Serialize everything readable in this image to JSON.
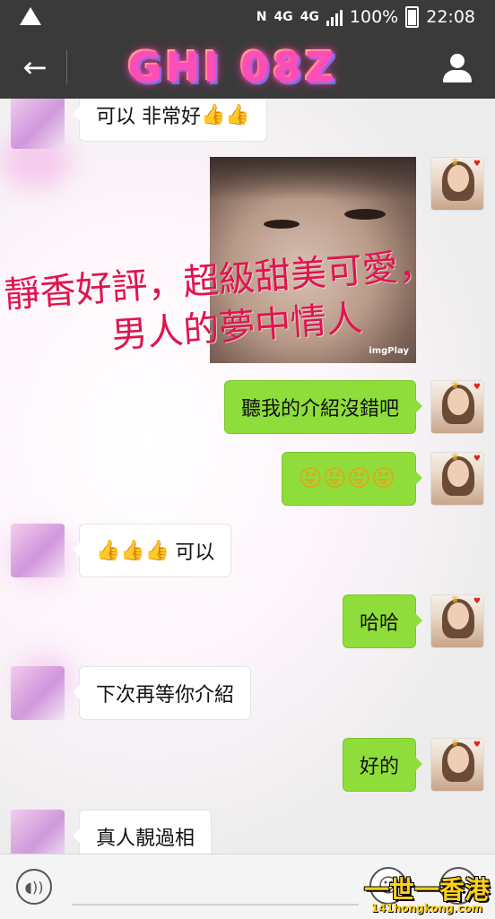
{
  "status_bar": {
    "nfc": "N",
    "net1": "4G",
    "net2": "4G",
    "battery": "100%",
    "time": "22:08"
  },
  "header": {
    "back_icon": "←",
    "title": "GHI 08Z"
  },
  "overlay": {
    "line1": "靜香好評，超級甜美可愛，",
    "line2": "男人的夢中情人"
  },
  "photo": {
    "watermark": "imgPlay"
  },
  "messages": [
    {
      "side": "left",
      "text": "可以 非常好",
      "thumbs": "👍👍"
    },
    {
      "side": "right",
      "type": "image"
    },
    {
      "side": "right",
      "text": "聽我的介紹沒錯吧"
    },
    {
      "side": "right",
      "emoji": "😝😝😝😝"
    },
    {
      "side": "left",
      "thumbs": "👍👍👍",
      "text": "可以"
    },
    {
      "side": "right",
      "text": "哈哈"
    },
    {
      "side": "left",
      "text": "下次再等你介紹"
    },
    {
      "side": "right",
      "text": "好的"
    },
    {
      "side": "left",
      "text": "真人靚過相"
    }
  ],
  "input_bar": {
    "voice_icon": "voice-icon",
    "emoji_icon": "emoji-icon",
    "plus_icon": "+"
  },
  "site_watermark": {
    "line1": "一世一香港",
    "line2": "141hongkong.com"
  },
  "colors": {
    "bubble_right": "#8fdd3a",
    "bubble_left": "#ffffff",
    "header_bg": "#3a3a3a",
    "overlay_text": "#e0144e"
  }
}
